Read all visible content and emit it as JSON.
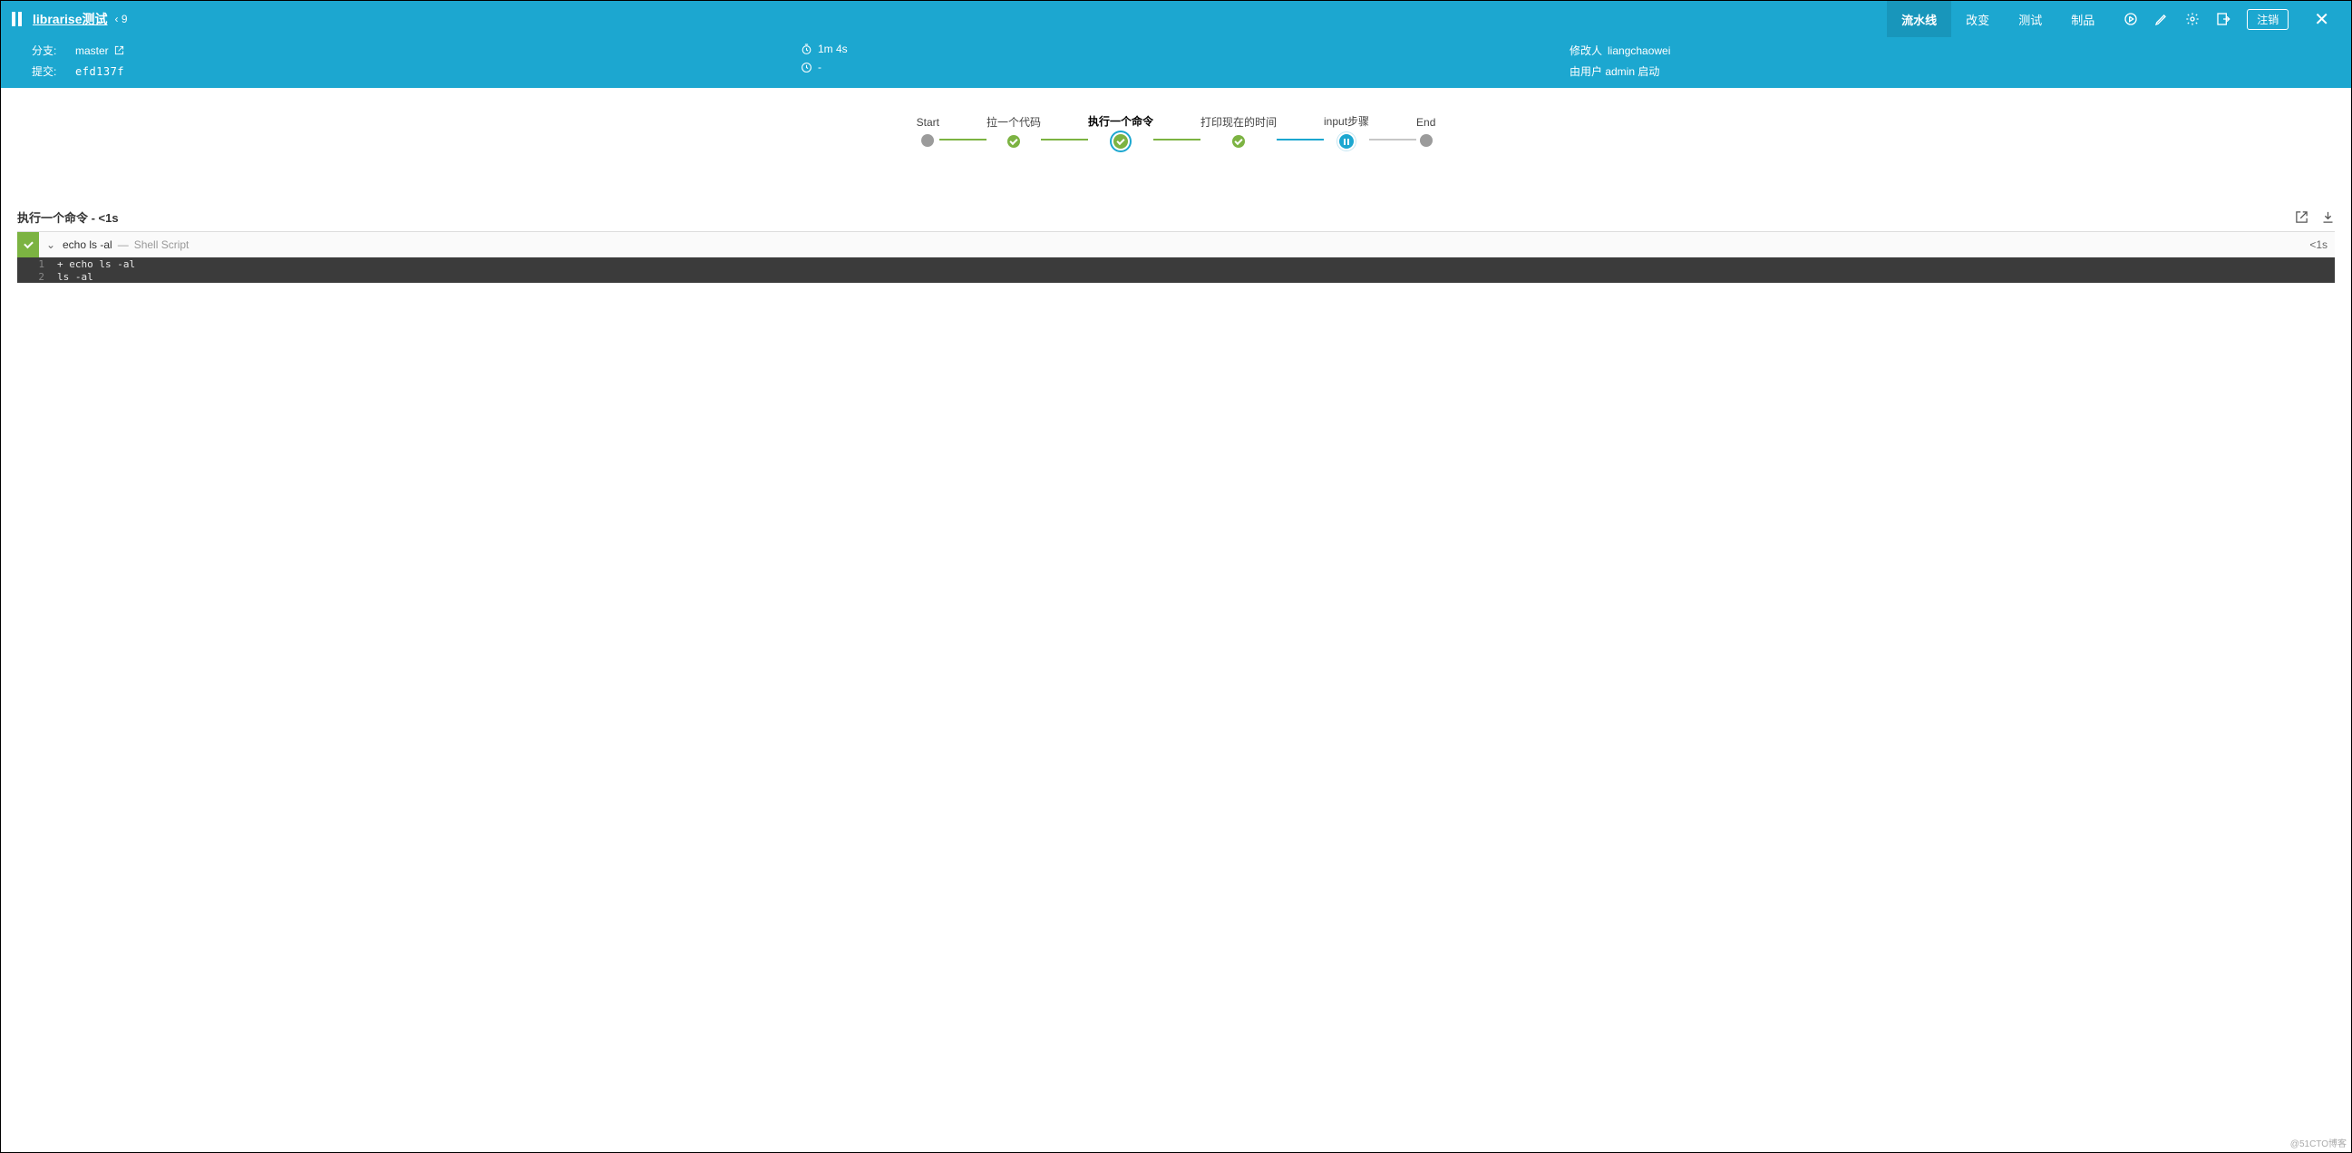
{
  "header": {
    "title": "librarise测试",
    "run_number": "9",
    "tabs": [
      {
        "label": "流水线",
        "active": true
      },
      {
        "label": "改变",
        "active": false
      },
      {
        "label": "测试",
        "active": false
      },
      {
        "label": "制品",
        "active": false
      }
    ],
    "logout": "注销"
  },
  "meta": {
    "branch_label": "分支:",
    "branch_value": "master",
    "commit_label": "提交:",
    "commit_value": "efd137f",
    "duration_label_icon": "clock",
    "duration_value": "1m 4s",
    "time_value": "-",
    "changed_by_label": "修改人",
    "changed_by_value": "liangchaowei",
    "started_by": "由用户 admin 启动"
  },
  "stages": [
    {
      "label": "Start",
      "state": "gray"
    },
    {
      "label": "拉一个代码",
      "state": "ok"
    },
    {
      "label": "执行一个命令",
      "state": "ok-ring",
      "active": true
    },
    {
      "label": "打印现在的时间",
      "state": "ok"
    },
    {
      "label": "input步骤",
      "state": "pause"
    },
    {
      "label": "End",
      "state": "gray"
    }
  ],
  "step": {
    "section_title": "执行一个命令 - <1s",
    "cmd": "echo ls -al",
    "type_sep": "—",
    "type": "Shell Script",
    "duration": "<1s",
    "log": [
      {
        "n": "1",
        "t": "+ echo ls -al"
      },
      {
        "n": "2",
        "t": "ls -al"
      }
    ]
  },
  "watermark": "@51CTO博客"
}
